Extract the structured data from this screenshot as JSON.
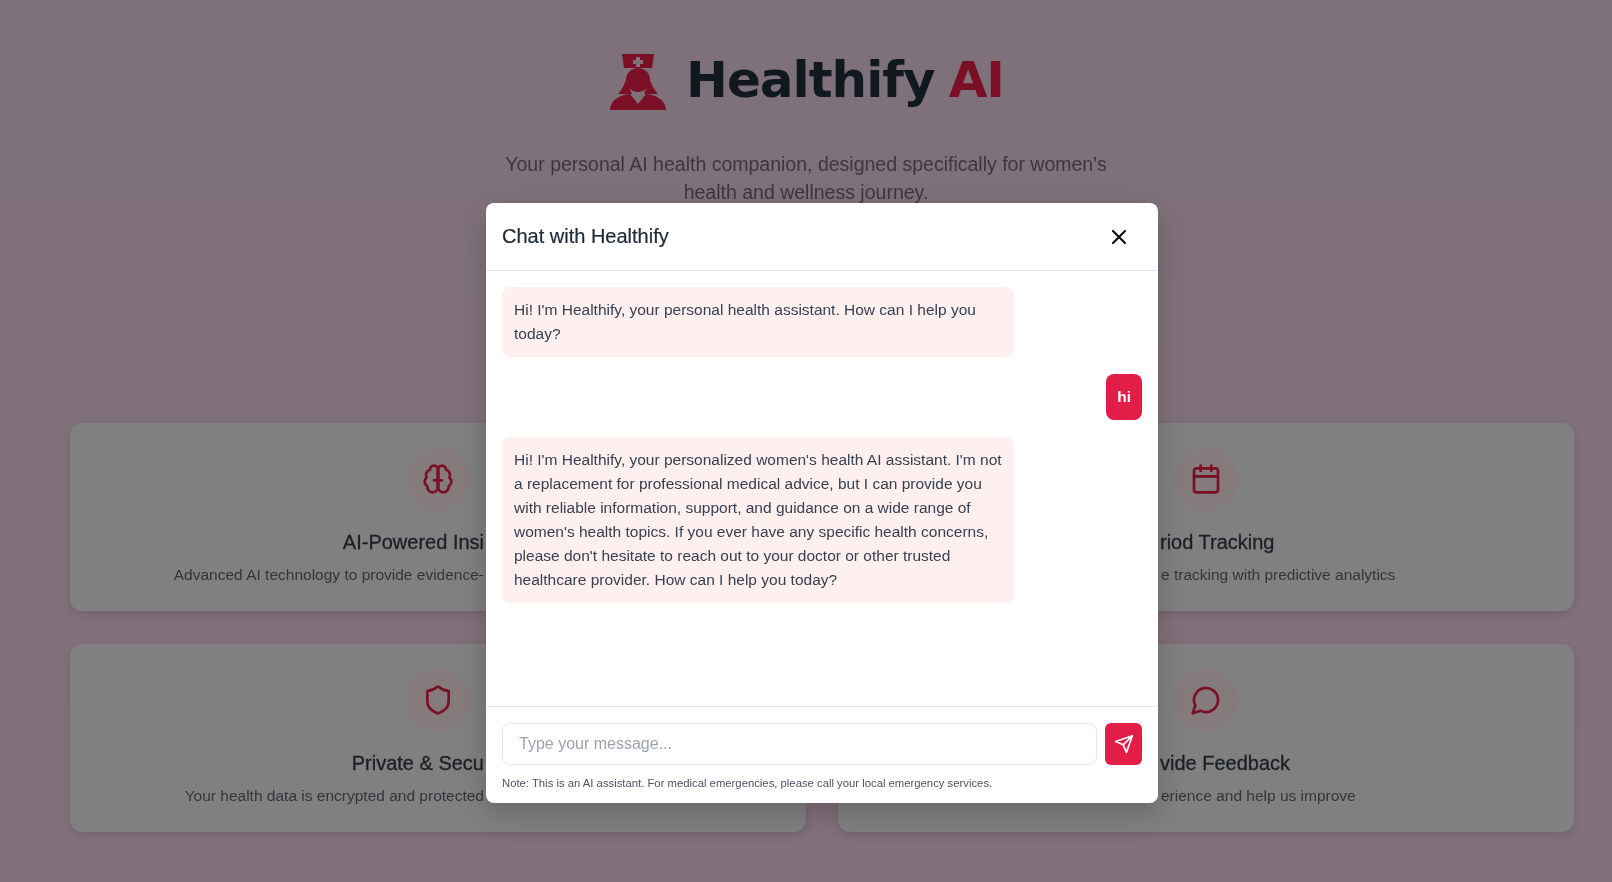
{
  "header": {
    "title": "Healthify",
    "title_accent": "AI",
    "subtitle": "Your personal AI health companion, designed specifically for women's health and wellness journey."
  },
  "feature_cards": [
    {
      "title": "AI-Powered Insi",
      "description": "Advanced AI technology to provide evidence-"
    },
    {
      "title": "riod Tracking",
      "description": "e tracking with predictive analytics"
    },
    {
      "title": "Private & Secu",
      "description": "Your health data is encrypted and protected"
    },
    {
      "title": "vide Feedback",
      "description": "erience and help us improve"
    }
  ],
  "chat": {
    "title": "Chat with Healthify",
    "messages": [
      {
        "kind": "bot",
        "text": "Hi! I'm Healthify, your personal health assistant. How can I help you today?"
      },
      {
        "kind": "user",
        "text": "hi"
      },
      {
        "kind": "bot",
        "text": "Hi! I'm Healthify, your personalized women's health AI assistant. I'm not a replacement for professional medical advice, but I can provide you with reliable information, support, and guidance on a wide range of women's health topics. If you ever have any specific health concerns, please don't hesitate to reach out to your doctor or other trusted healthcare provider. How can I help you today?"
      }
    ],
    "input": {
      "placeholder": "Type your message..."
    },
    "note": "Note: This is an AI assistant. For medical emergencies, please call your local emergency services."
  }
}
